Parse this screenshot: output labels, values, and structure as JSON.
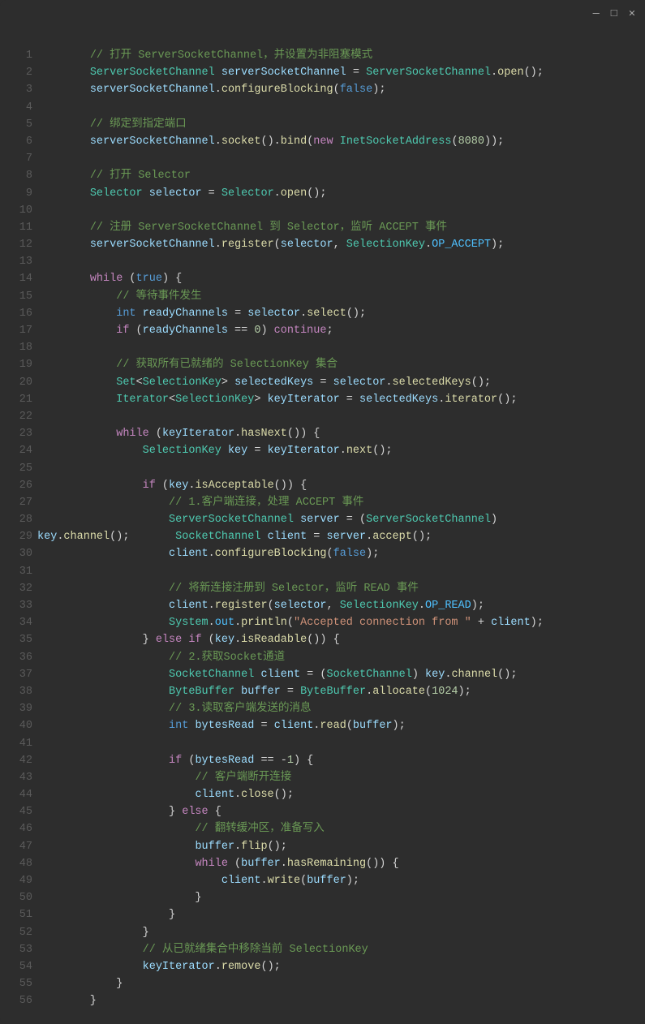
{
  "window": {
    "minimize": "—",
    "maximize": "□",
    "close": "✕"
  },
  "lines": [
    {
      "n": 1,
      "tokens": [
        [
          "op",
          "        "
        ],
        [
          "cm",
          "// 打开 ServerSocketChannel，并设置为非阻塞模式"
        ]
      ]
    },
    {
      "n": 2,
      "tokens": [
        [
          "op",
          "        "
        ],
        [
          "ty",
          "ServerSocketChannel"
        ],
        [
          "op",
          " "
        ],
        [
          "id",
          "serverSocketChannel"
        ],
        [
          "op",
          " = "
        ],
        [
          "ty",
          "ServerSocketChannel"
        ],
        [
          "op",
          "."
        ],
        [
          "fn",
          "open"
        ],
        [
          "op",
          "();"
        ]
      ]
    },
    {
      "n": 3,
      "tokens": [
        [
          "op",
          "        "
        ],
        [
          "id",
          "serverSocketChannel"
        ],
        [
          "op",
          "."
        ],
        [
          "fn",
          "configureBlocking"
        ],
        [
          "op",
          "("
        ],
        [
          "kw2",
          "false"
        ],
        [
          "op",
          ");"
        ]
      ]
    },
    {
      "n": 4,
      "tokens": [
        [
          "op",
          ""
        ]
      ]
    },
    {
      "n": 5,
      "tokens": [
        [
          "op",
          "        "
        ],
        [
          "cm",
          "// 绑定到指定端口"
        ]
      ]
    },
    {
      "n": 6,
      "tokens": [
        [
          "op",
          "        "
        ],
        [
          "id",
          "serverSocketChannel"
        ],
        [
          "op",
          "."
        ],
        [
          "fn",
          "socket"
        ],
        [
          "op",
          "()."
        ],
        [
          "fn",
          "bind"
        ],
        [
          "op",
          "("
        ],
        [
          "kw",
          "new"
        ],
        [
          "op",
          " "
        ],
        [
          "ty",
          "InetSocketAddress"
        ],
        [
          "op",
          "("
        ],
        [
          "num",
          "8080"
        ],
        [
          "op",
          "));"
        ]
      ]
    },
    {
      "n": 7,
      "tokens": [
        [
          "op",
          ""
        ]
      ]
    },
    {
      "n": 8,
      "tokens": [
        [
          "op",
          "        "
        ],
        [
          "cm",
          "// 打开 Selector"
        ]
      ]
    },
    {
      "n": 9,
      "tokens": [
        [
          "op",
          "        "
        ],
        [
          "ty",
          "Selector"
        ],
        [
          "op",
          " "
        ],
        [
          "id",
          "selector"
        ],
        [
          "op",
          " = "
        ],
        [
          "ty",
          "Selector"
        ],
        [
          "op",
          "."
        ],
        [
          "fn",
          "open"
        ],
        [
          "op",
          "();"
        ]
      ]
    },
    {
      "n": 10,
      "tokens": [
        [
          "op",
          ""
        ]
      ]
    },
    {
      "n": 11,
      "tokens": [
        [
          "op",
          "        "
        ],
        [
          "cm",
          "// 注册 ServerSocketChannel 到 Selector，监听 ACCEPT 事件"
        ]
      ]
    },
    {
      "n": 12,
      "tokens": [
        [
          "op",
          "        "
        ],
        [
          "id",
          "serverSocketChannel"
        ],
        [
          "op",
          "."
        ],
        [
          "fn",
          "register"
        ],
        [
          "op",
          "("
        ],
        [
          "id",
          "selector"
        ],
        [
          "op",
          ", "
        ],
        [
          "ty",
          "SelectionKey"
        ],
        [
          "op",
          "."
        ],
        [
          "fld",
          "OP_ACCEPT"
        ],
        [
          "op",
          ");"
        ]
      ]
    },
    {
      "n": 13,
      "tokens": [
        [
          "op",
          ""
        ]
      ]
    },
    {
      "n": 14,
      "tokens": [
        [
          "op",
          "        "
        ],
        [
          "kw",
          "while"
        ],
        [
          "op",
          " ("
        ],
        [
          "kw2",
          "true"
        ],
        [
          "op",
          ") {"
        ]
      ]
    },
    {
      "n": 15,
      "tokens": [
        [
          "op",
          "            "
        ],
        [
          "cm",
          "// 等待事件发生"
        ]
      ]
    },
    {
      "n": 16,
      "tokens": [
        [
          "op",
          "            "
        ],
        [
          "prim",
          "int"
        ],
        [
          "op",
          " "
        ],
        [
          "id",
          "readyChannels"
        ],
        [
          "op",
          " = "
        ],
        [
          "id",
          "selector"
        ],
        [
          "op",
          "."
        ],
        [
          "fn",
          "select"
        ],
        [
          "op",
          "();"
        ]
      ]
    },
    {
      "n": 17,
      "tokens": [
        [
          "op",
          "            "
        ],
        [
          "kw",
          "if"
        ],
        [
          "op",
          " ("
        ],
        [
          "id",
          "readyChannels"
        ],
        [
          "op",
          " == "
        ],
        [
          "num",
          "0"
        ],
        [
          "op",
          ") "
        ],
        [
          "kw",
          "continue"
        ],
        [
          "op",
          ";"
        ]
      ]
    },
    {
      "n": 18,
      "tokens": [
        [
          "op",
          ""
        ]
      ]
    },
    {
      "n": 19,
      "tokens": [
        [
          "op",
          "            "
        ],
        [
          "cm",
          "// 获取所有已就绪的 SelectionKey 集合"
        ]
      ]
    },
    {
      "n": 20,
      "tokens": [
        [
          "op",
          "            "
        ],
        [
          "ty",
          "Set"
        ],
        [
          "op",
          "<"
        ],
        [
          "ty",
          "SelectionKey"
        ],
        [
          "op",
          "> "
        ],
        [
          "id",
          "selectedKeys"
        ],
        [
          "op",
          " = "
        ],
        [
          "id",
          "selector"
        ],
        [
          "op",
          "."
        ],
        [
          "fn",
          "selectedKeys"
        ],
        [
          "op",
          "();"
        ]
      ]
    },
    {
      "n": 21,
      "tokens": [
        [
          "op",
          "            "
        ],
        [
          "ty",
          "Iterator"
        ],
        [
          "op",
          "<"
        ],
        [
          "ty",
          "SelectionKey"
        ],
        [
          "op",
          "> "
        ],
        [
          "id",
          "keyIterator"
        ],
        [
          "op",
          " = "
        ],
        [
          "id",
          "selectedKeys"
        ],
        [
          "op",
          "."
        ],
        [
          "fn",
          "iterator"
        ],
        [
          "op",
          "();"
        ]
      ]
    },
    {
      "n": 22,
      "tokens": [
        [
          "op",
          ""
        ]
      ]
    },
    {
      "n": 23,
      "tokens": [
        [
          "op",
          "            "
        ],
        [
          "kw",
          "while"
        ],
        [
          "op",
          " ("
        ],
        [
          "id",
          "keyIterator"
        ],
        [
          "op",
          "."
        ],
        [
          "fn",
          "hasNext"
        ],
        [
          "op",
          "()) {"
        ]
      ]
    },
    {
      "n": 24,
      "tokens": [
        [
          "op",
          "                "
        ],
        [
          "ty",
          "SelectionKey"
        ],
        [
          "op",
          " "
        ],
        [
          "id",
          "key"
        ],
        [
          "op",
          " = "
        ],
        [
          "id",
          "keyIterator"
        ],
        [
          "op",
          "."
        ],
        [
          "fn",
          "next"
        ],
        [
          "op",
          "();"
        ]
      ]
    },
    {
      "n": 25,
      "tokens": [
        [
          "op",
          ""
        ]
      ]
    },
    {
      "n": 26,
      "tokens": [
        [
          "op",
          "                "
        ],
        [
          "kw",
          "if"
        ],
        [
          "op",
          " ("
        ],
        [
          "id",
          "key"
        ],
        [
          "op",
          "."
        ],
        [
          "fn",
          "isAcceptable"
        ],
        [
          "op",
          "()) {"
        ]
      ]
    },
    {
      "n": 27,
      "tokens": [
        [
          "op",
          "                    "
        ],
        [
          "cm",
          "// 1.客户端连接，处理 ACCEPT 事件"
        ]
      ]
    },
    {
      "n": 28,
      "tokens": [
        [
          "op",
          "                    "
        ],
        [
          "ty",
          "ServerSocketChannel"
        ],
        [
          "op",
          " "
        ],
        [
          "id",
          "server"
        ],
        [
          "op",
          " = ("
        ],
        [
          "ty",
          "ServerSocketChannel"
        ],
        [
          "op",
          ") "
        ]
      ]
    },
    {
      "n": 29,
      "tokens": [
        [
          "id",
          "key"
        ],
        [
          "op",
          "."
        ],
        [
          "fn",
          "channel"
        ],
        [
          "op",
          "();       "
        ],
        [
          "ty",
          "SocketChannel"
        ],
        [
          "op",
          " "
        ],
        [
          "id",
          "client"
        ],
        [
          "op",
          " = "
        ],
        [
          "id",
          "server"
        ],
        [
          "op",
          "."
        ],
        [
          "fn",
          "accept"
        ],
        [
          "op",
          "();"
        ]
      ]
    },
    {
      "n": 30,
      "tokens": [
        [
          "op",
          "                    "
        ],
        [
          "id",
          "client"
        ],
        [
          "op",
          "."
        ],
        [
          "fn",
          "configureBlocking"
        ],
        [
          "op",
          "("
        ],
        [
          "kw2",
          "false"
        ],
        [
          "op",
          ");"
        ]
      ]
    },
    {
      "n": 31,
      "tokens": [
        [
          "op",
          ""
        ]
      ]
    },
    {
      "n": 32,
      "tokens": [
        [
          "op",
          "                    "
        ],
        [
          "cm",
          "// 将新连接注册到 Selector，监听 READ 事件"
        ]
      ]
    },
    {
      "n": 33,
      "tokens": [
        [
          "op",
          "                    "
        ],
        [
          "id",
          "client"
        ],
        [
          "op",
          "."
        ],
        [
          "fn",
          "register"
        ],
        [
          "op",
          "("
        ],
        [
          "id",
          "selector"
        ],
        [
          "op",
          ", "
        ],
        [
          "ty",
          "SelectionKey"
        ],
        [
          "op",
          "."
        ],
        [
          "fld",
          "OP_READ"
        ],
        [
          "op",
          ");"
        ]
      ]
    },
    {
      "n": 34,
      "tokens": [
        [
          "op",
          "                    "
        ],
        [
          "ty",
          "System"
        ],
        [
          "op",
          "."
        ],
        [
          "fld",
          "out"
        ],
        [
          "op",
          "."
        ],
        [
          "fn",
          "println"
        ],
        [
          "op",
          "("
        ],
        [
          "str",
          "\"Accepted connection from \""
        ],
        [
          "op",
          " + "
        ],
        [
          "id",
          "client"
        ],
        [
          "op",
          ");"
        ]
      ]
    },
    {
      "n": 35,
      "tokens": [
        [
          "op",
          "                } "
        ],
        [
          "kw",
          "else"
        ],
        [
          "op",
          " "
        ],
        [
          "kw",
          "if"
        ],
        [
          "op",
          " ("
        ],
        [
          "id",
          "key"
        ],
        [
          "op",
          "."
        ],
        [
          "fn",
          "isReadable"
        ],
        [
          "op",
          "()) {"
        ]
      ]
    },
    {
      "n": 36,
      "tokens": [
        [
          "op",
          "                    "
        ],
        [
          "cm",
          "// 2.获取Socket通道"
        ]
      ]
    },
    {
      "n": 37,
      "tokens": [
        [
          "op",
          "                    "
        ],
        [
          "ty",
          "SocketChannel"
        ],
        [
          "op",
          " "
        ],
        [
          "id",
          "client"
        ],
        [
          "op",
          " = ("
        ],
        [
          "ty",
          "SocketChannel"
        ],
        [
          "op",
          ") "
        ],
        [
          "id",
          "key"
        ],
        [
          "op",
          "."
        ],
        [
          "fn",
          "channel"
        ],
        [
          "op",
          "();"
        ]
      ]
    },
    {
      "n": 38,
      "tokens": [
        [
          "op",
          "                    "
        ],
        [
          "ty",
          "ByteBuffer"
        ],
        [
          "op",
          " "
        ],
        [
          "id",
          "buffer"
        ],
        [
          "op",
          " = "
        ],
        [
          "ty",
          "ByteBuffer"
        ],
        [
          "op",
          "."
        ],
        [
          "fn",
          "allocate"
        ],
        [
          "op",
          "("
        ],
        [
          "num",
          "1024"
        ],
        [
          "op",
          ");"
        ]
      ]
    },
    {
      "n": 39,
      "tokens": [
        [
          "op",
          "                    "
        ],
        [
          "cm",
          "// 3.读取客户端发送的消息"
        ]
      ]
    },
    {
      "n": 40,
      "tokens": [
        [
          "op",
          "                    "
        ],
        [
          "prim",
          "int"
        ],
        [
          "op",
          " "
        ],
        [
          "id",
          "bytesRead"
        ],
        [
          "op",
          " = "
        ],
        [
          "id",
          "client"
        ],
        [
          "op",
          "."
        ],
        [
          "fn",
          "read"
        ],
        [
          "op",
          "("
        ],
        [
          "id",
          "buffer"
        ],
        [
          "op",
          ");"
        ]
      ]
    },
    {
      "n": 41,
      "tokens": [
        [
          "op",
          ""
        ]
      ]
    },
    {
      "n": 42,
      "tokens": [
        [
          "op",
          "                    "
        ],
        [
          "kw",
          "if"
        ],
        [
          "op",
          " ("
        ],
        [
          "id",
          "bytesRead"
        ],
        [
          "op",
          " == -"
        ],
        [
          "num",
          "1"
        ],
        [
          "op",
          ") {"
        ]
      ]
    },
    {
      "n": 43,
      "tokens": [
        [
          "op",
          "                        "
        ],
        [
          "cm",
          "// 客户端断开连接"
        ]
      ]
    },
    {
      "n": 44,
      "tokens": [
        [
          "op",
          "                        "
        ],
        [
          "id",
          "client"
        ],
        [
          "op",
          "."
        ],
        [
          "fn",
          "close"
        ],
        [
          "op",
          "();"
        ]
      ]
    },
    {
      "n": 45,
      "tokens": [
        [
          "op",
          "                    } "
        ],
        [
          "kw",
          "else"
        ],
        [
          "op",
          " {"
        ]
      ]
    },
    {
      "n": 46,
      "tokens": [
        [
          "op",
          "                        "
        ],
        [
          "cm",
          "// 翻转缓冲区，准备写入"
        ]
      ]
    },
    {
      "n": 47,
      "tokens": [
        [
          "op",
          "                        "
        ],
        [
          "id",
          "buffer"
        ],
        [
          "op",
          "."
        ],
        [
          "fn",
          "flip"
        ],
        [
          "op",
          "();"
        ]
      ]
    },
    {
      "n": 48,
      "tokens": [
        [
          "op",
          "                        "
        ],
        [
          "kw",
          "while"
        ],
        [
          "op",
          " ("
        ],
        [
          "id",
          "buffer"
        ],
        [
          "op",
          "."
        ],
        [
          "fn",
          "hasRemaining"
        ],
        [
          "op",
          "()) {"
        ]
      ]
    },
    {
      "n": 49,
      "tokens": [
        [
          "op",
          "                            "
        ],
        [
          "id",
          "client"
        ],
        [
          "op",
          "."
        ],
        [
          "fn",
          "write"
        ],
        [
          "op",
          "("
        ],
        [
          "id",
          "buffer"
        ],
        [
          "op",
          ");"
        ]
      ]
    },
    {
      "n": 50,
      "tokens": [
        [
          "op",
          "                        }"
        ]
      ]
    },
    {
      "n": 51,
      "tokens": [
        [
          "op",
          "                    }"
        ]
      ]
    },
    {
      "n": 52,
      "tokens": [
        [
          "op",
          "                }"
        ]
      ]
    },
    {
      "n": 53,
      "tokens": [
        [
          "op",
          "                "
        ],
        [
          "cm",
          "// 从已就绪集合中移除当前 SelectionKey"
        ]
      ]
    },
    {
      "n": 54,
      "tokens": [
        [
          "op",
          "                "
        ],
        [
          "id",
          "keyIterator"
        ],
        [
          "op",
          "."
        ],
        [
          "fn",
          "remove"
        ],
        [
          "op",
          "();"
        ]
      ]
    },
    {
      "n": 55,
      "tokens": [
        [
          "op",
          "            }"
        ]
      ]
    },
    {
      "n": 56,
      "tokens": [
        [
          "op",
          "        }"
        ]
      ]
    }
  ]
}
